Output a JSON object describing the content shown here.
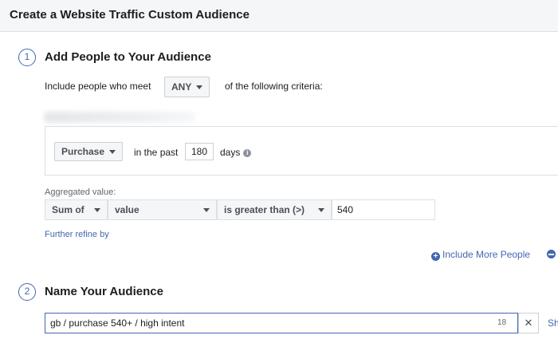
{
  "header": {
    "title": "Create a Website Traffic Custom Audience"
  },
  "step1": {
    "number": "1",
    "title": "Add People to Your Audience",
    "include_prefix": "Include people who meet",
    "match_dropdown": "ANY",
    "include_suffix": "of the following criteria:",
    "rule": {
      "event_dropdown": "Purchase",
      "in_past_label": "in the past",
      "days_value": "180",
      "days_label": "days"
    },
    "aggregated": {
      "label": "Aggregated value:",
      "function_dropdown": "Sum of",
      "field_dropdown": "value",
      "operator_dropdown": "is greater than (>)",
      "threshold_value": "540"
    },
    "refine_link": "Further refine by",
    "include_more_link": "Include More People"
  },
  "step2": {
    "number": "2",
    "title": "Name Your Audience",
    "name_value": "gb / purchase 540+ / high intent",
    "char_count": "18",
    "clear_symbol": "✕",
    "cut_off_text": "Sh"
  },
  "colors": {
    "accent": "#4267b2",
    "border": "#dddfe2",
    "button_bg": "#f5f6f7"
  },
  "icons": [
    "info-icon",
    "caret-down-icon",
    "plus-circle-icon",
    "minus-circle-icon",
    "close-icon"
  ]
}
